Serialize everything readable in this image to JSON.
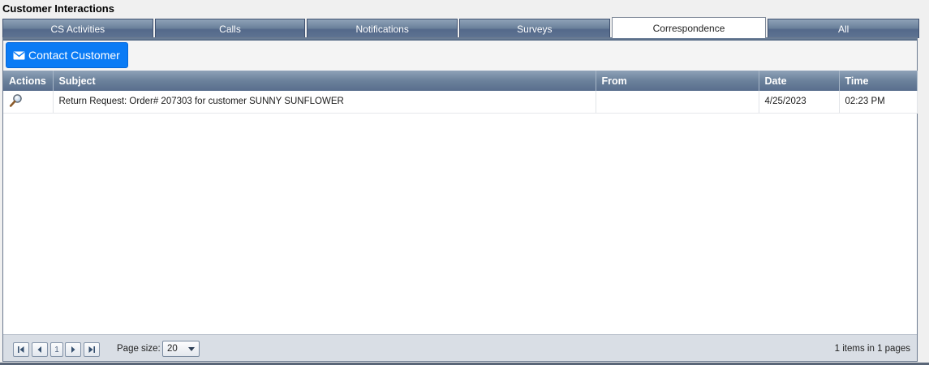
{
  "title": "Customer Interactions",
  "tabs": [
    {
      "label": "CS Activities",
      "active": false
    },
    {
      "label": "Calls",
      "active": false
    },
    {
      "label": "Notifications",
      "active": false
    },
    {
      "label": "Surveys",
      "active": false
    },
    {
      "label": "Correspondence",
      "active": true
    },
    {
      "label": "All",
      "active": false
    }
  ],
  "toolbar": {
    "contact_label": "Contact Customer",
    "contact_icon": "envelope-icon",
    "contact_color": "#0a7bf5"
  },
  "grid": {
    "columns": [
      "Actions",
      "Subject",
      "From",
      "Date",
      "Time"
    ],
    "rows": [
      {
        "action_icon": "magnifier-icon",
        "subject": "Return Request: Order# 207303 for customer SUNNY SUNFLOWER",
        "from": "",
        "date": "4/25/2023",
        "time": "02:23 PM"
      }
    ]
  },
  "pager": {
    "current_page": "1",
    "page_size_label": "Page size:",
    "page_size_value": "20",
    "info": "1 items in 1 pages"
  }
}
